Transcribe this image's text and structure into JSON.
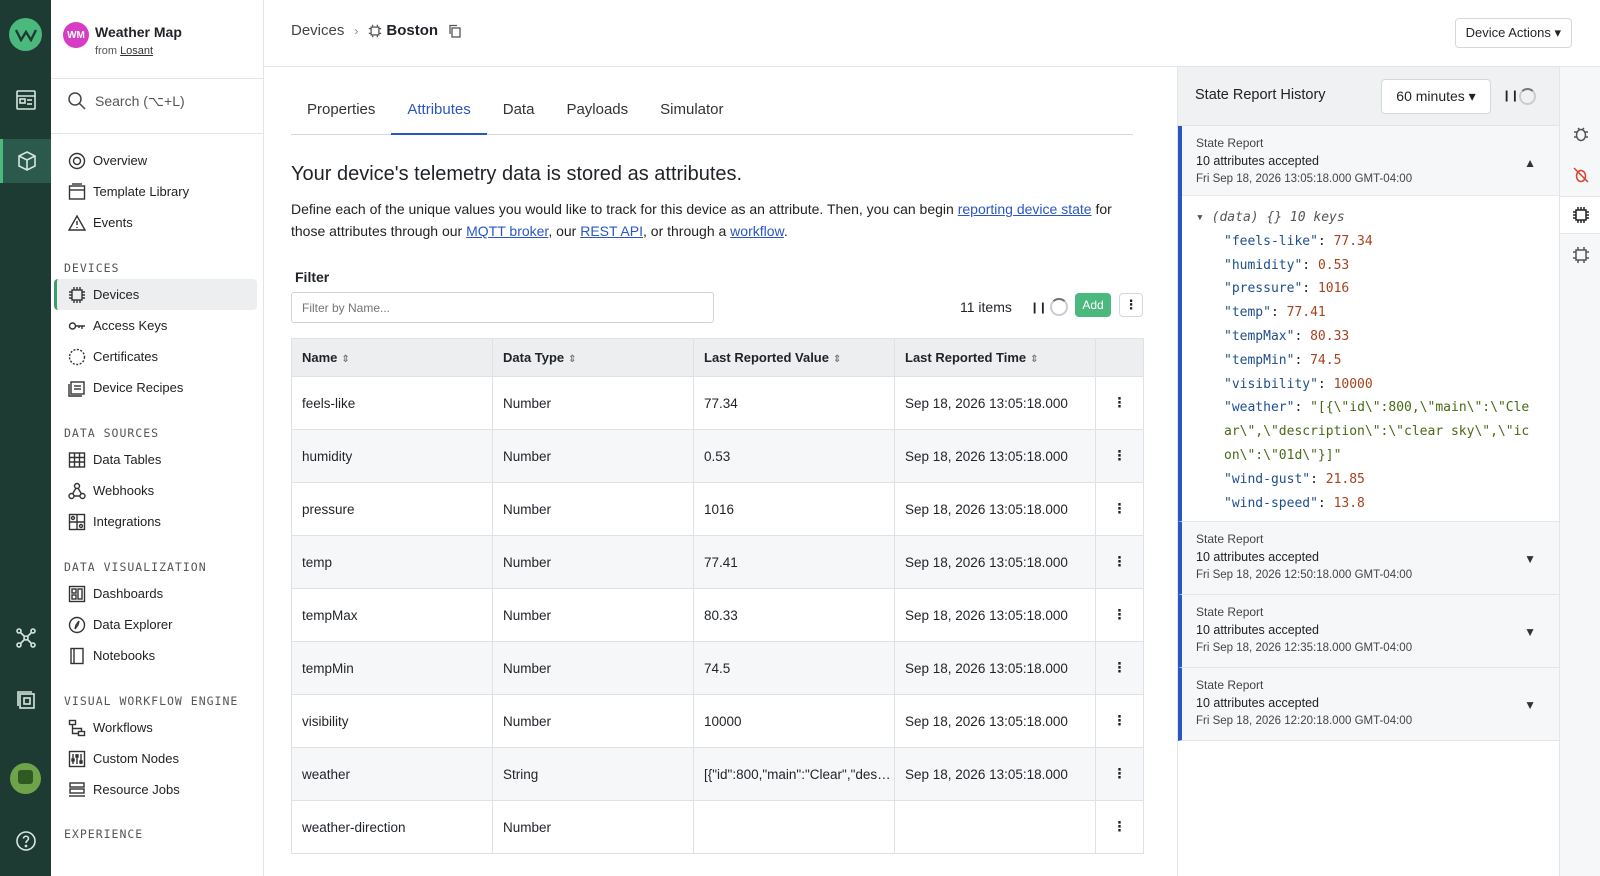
{
  "app": {
    "badge": "WM",
    "name": "Weather Map",
    "from_label": "from",
    "from_org": "Losant"
  },
  "search": {
    "placeholder": "Search (⌥+L)"
  },
  "nav": {
    "top": [
      {
        "label": "Overview",
        "icon": "overview-icon"
      },
      {
        "label": "Template Library",
        "icon": "template-icon"
      },
      {
        "label": "Events",
        "icon": "warning-icon"
      }
    ],
    "sections": [
      {
        "title": "DEVICES",
        "items": [
          "Devices",
          "Access Keys",
          "Certificates",
          "Device Recipes"
        ]
      },
      {
        "title": "DATA SOURCES",
        "items": [
          "Data Tables",
          "Webhooks",
          "Integrations"
        ]
      },
      {
        "title": "DATA VISUALIZATION",
        "items": [
          "Dashboards",
          "Data Explorer",
          "Notebooks"
        ]
      },
      {
        "title": "VISUAL WORKFLOW ENGINE",
        "items": [
          "Workflows",
          "Custom Nodes",
          "Resource Jobs"
        ]
      },
      {
        "title": "EXPERIENCE",
        "items": []
      }
    ],
    "active": "Devices"
  },
  "breadcrumb": {
    "parent": "Devices",
    "current": "Boston"
  },
  "device_actions": "Device Actions ▾",
  "tabs": [
    "Properties",
    "Attributes",
    "Data",
    "Payloads",
    "Simulator"
  ],
  "active_tab": "Attributes",
  "heading": "Your device's telemetry data is stored as attributes.",
  "intro": {
    "p1": "Define each of the unique values you would like to track for this device as an attribute. Then, you can begin ",
    "link1": "reporting device state",
    "p2": " for those attributes through our ",
    "link2": "MQTT broker",
    "p3": ", our ",
    "link3": "REST API",
    "p4": ", or through a ",
    "link4": "workflow",
    "p5": "."
  },
  "filter": {
    "label": "Filter",
    "placeholder": "Filter by Name..."
  },
  "items_count": "11 items",
  "add_label": "Add",
  "table": {
    "headers": [
      "Name",
      "Data Type",
      "Last Reported Value",
      "Last Reported Time"
    ],
    "rows": [
      [
        "feels-like",
        "Number",
        "77.34",
        "Sep 18, 2026 13:05:18.000"
      ],
      [
        "humidity",
        "Number",
        "0.53",
        "Sep 18, 2026 13:05:18.000"
      ],
      [
        "pressure",
        "Number",
        "1016",
        "Sep 18, 2026 13:05:18.000"
      ],
      [
        "temp",
        "Number",
        "77.41",
        "Sep 18, 2026 13:05:18.000"
      ],
      [
        "tempMax",
        "Number",
        "80.33",
        "Sep 18, 2026 13:05:18.000"
      ],
      [
        "tempMin",
        "Number",
        "74.5",
        "Sep 18, 2026 13:05:18.000"
      ],
      [
        "visibility",
        "Number",
        "10000",
        "Sep 18, 2026 13:05:18.000"
      ],
      [
        "weather",
        "String",
        "[{\"id\":800,\"main\":\"Clear\",\"description\":\"clear sky\",\"icon\":\"01d\"}]",
        "Sep 18, 2026 13:05:18.000"
      ],
      [
        "weather-direction",
        "Number",
        "",
        ""
      ]
    ]
  },
  "panel": {
    "title": "State Report History",
    "range": "60 minutes ▾",
    "reports": [
      {
        "label": "State Report",
        "summary": "10 attributes accepted",
        "time": "Fri Sep 18, 2026 13:05:18.000 GMT-04:00",
        "expanded": true
      },
      {
        "label": "State Report",
        "summary": "10 attributes accepted",
        "time": "Fri Sep 18, 2026 12:50:18.000 GMT-04:00",
        "expanded": false
      },
      {
        "label": "State Report",
        "summary": "10 attributes accepted",
        "time": "Fri Sep 18, 2026 12:35:18.000 GMT-04:00",
        "expanded": false
      },
      {
        "label": "State Report",
        "summary": "10 attributes accepted",
        "time": "Fri Sep 18, 2026 12:20:18.000 GMT-04:00",
        "expanded": false
      }
    ],
    "json_header": "▾ (data)  {}  10 keys",
    "json": [
      {
        "k": "\"feels-like\"",
        "v": "77.34",
        "t": "n"
      },
      {
        "k": "\"humidity\"",
        "v": "0.53",
        "t": "n"
      },
      {
        "k": "\"pressure\"",
        "v": "1016",
        "t": "n"
      },
      {
        "k": "\"temp\"",
        "v": "77.41",
        "t": "n"
      },
      {
        "k": "\"tempMax\"",
        "v": "80.33",
        "t": "n"
      },
      {
        "k": "\"tempMin\"",
        "v": "74.5",
        "t": "n"
      },
      {
        "k": "\"visibility\"",
        "v": "10000",
        "t": "n"
      },
      {
        "k": "\"weather\"",
        "v": "\"[{\\\"id\\\":800,\\\"main\\\":\\\"Clear\\\",\\\"description\\\":\\\"clear sky\\\",\\\"icon\\\":\\\"01d\\\"}]\"",
        "t": "s"
      },
      {
        "k": "\"wind-gust\"",
        "v": "21.85",
        "t": "n"
      },
      {
        "k": "\"wind-speed\"",
        "v": "13.8",
        "t": "n"
      }
    ]
  },
  "colors": {
    "accent": "#2a56c4",
    "brand": "#4bb87e",
    "rail": "#1d3b33"
  }
}
